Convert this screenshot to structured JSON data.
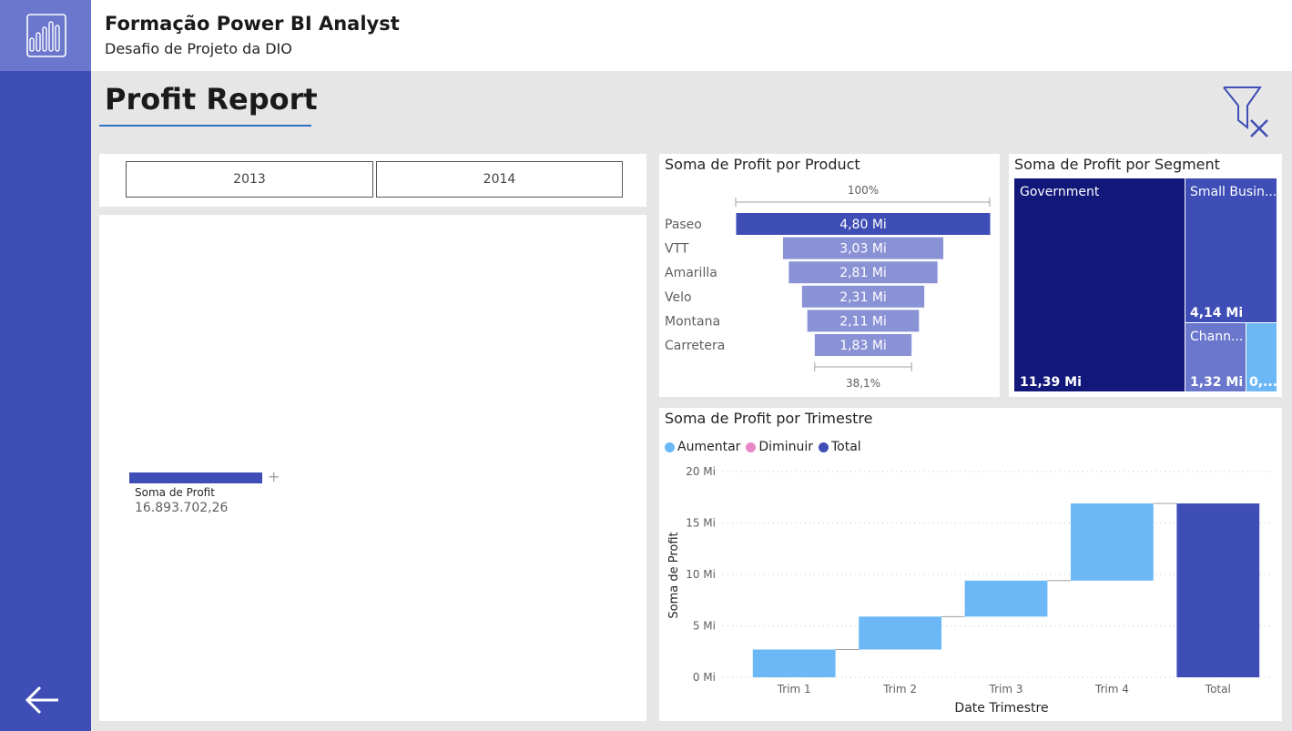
{
  "header": {
    "title": "Formação Power BI Analyst",
    "subtitle": "Desafio de Projeto da DIO"
  },
  "report": {
    "title": "Profit Report"
  },
  "colors": {
    "rail": "#3f4eb6",
    "accent": "#3f4eb6",
    "funnel_top": "#3f4eb6",
    "funnel_other": "#8a92d6",
    "increase": "#6cb8f6",
    "decrease": "#e887c8",
    "total": "#3f4eb6",
    "segment_dark": "#12177a"
  },
  "slicer": {
    "options": [
      "2013",
      "2014"
    ]
  },
  "kpi": {
    "label": "Soma de Profit",
    "value": "16.893.702,26"
  },
  "icons": {
    "logo": "power-bi-report-icon",
    "clear_filters": "funnel-clear-icon",
    "back": "back-arrow-icon",
    "add": "plus-icon"
  },
  "funnel": {
    "title": "Soma de Profit por Product",
    "top_pct": "100%",
    "bottom_pct": "38,1%",
    "chart_data": {
      "type": "funnel",
      "categories": [
        "Paseo",
        "VTT",
        "Amarilla",
        "Velo",
        "Montana",
        "Carretera"
      ],
      "values": [
        4.8,
        3.03,
        2.81,
        2.31,
        2.11,
        1.83
      ],
      "labels": [
        "4,80 Mi",
        "3,03 Mi",
        "2,81 Mi",
        "2,31 Mi",
        "2,11 Mi",
        "1,83 Mi"
      ]
    }
  },
  "treemap": {
    "title": "Soma de Profit por Segment",
    "chart_data": {
      "type": "treemap",
      "items": [
        {
          "name": "Government",
          "value": 11.39,
          "label": "11,39 Mi",
          "value_shown": true
        },
        {
          "name": "Small Busin...",
          "value": 4.14,
          "label": "4,14 Mi",
          "value_shown": true
        },
        {
          "name": "Chann...",
          "value": 1.32,
          "label": "1,32 Mi",
          "value_shown": true
        },
        {
          "name": "",
          "value": 0.3,
          "label": "0,...",
          "value_shown": true
        }
      ]
    }
  },
  "waterfall": {
    "title": "Soma de Profit por Trimestre",
    "legend": [
      "Aumentar",
      "Diminuir",
      "Total"
    ],
    "chart_data": {
      "type": "waterfall",
      "categories": [
        "Trim 1",
        "Trim 2",
        "Trim 3",
        "Trim 4",
        "Total"
      ],
      "values": [
        2.7,
        3.2,
        3.5,
        7.5,
        16.9
      ],
      "is_total": [
        false,
        false,
        false,
        false,
        true
      ],
      "ylabel": "Soma de Profit",
      "xlabel": "Date Trimestre",
      "yticks": [
        "0 Mi",
        "5 Mi",
        "10 Mi",
        "15 Mi",
        "20 Mi"
      ],
      "ylim": [
        0,
        20
      ],
      "grid": true,
      "legend_position": "top-left"
    }
  }
}
